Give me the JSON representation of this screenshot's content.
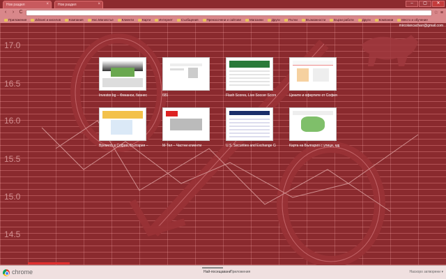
{
  "tabs": [
    {
      "label": "Нов раздел",
      "active": true
    },
    {
      "label": "Нов раздел",
      "active": false
    }
  ],
  "window": {
    "minimize": "–",
    "maximize": "▢",
    "close": "✕"
  },
  "toolbar": {
    "back": "‹",
    "forward": "›",
    "reload": "C",
    "omnibox_value": "",
    "star": "☆",
    "menu": "≡"
  },
  "bookmarks": [
    "Приложения",
    "Zdravei и киселов",
    "Компания",
    "Нос.Маговстье",
    "Клиенти",
    "Карти",
    "Интернет",
    "Съобщения",
    "Пренасочени и сайтове",
    "Магазини",
    "Други",
    "Пътни",
    "Възможности",
    "Бързи работи",
    "Други",
    "Компании",
    "Място и обучение"
  ],
  "user_email": "mircolancacharr@gmail.com",
  "axis_labels": [
    "17.0",
    "16.5",
    "16.0",
    "15.5",
    "15.0",
    "14.5"
  ],
  "thumbnails": [
    {
      "caption": "Investor.bg – Финанси, бизнес",
      "style": "investor"
    },
    {
      "caption": "681",
      "style": "plain"
    },
    {
      "caption": "Flash Scores, Live Soccer Scores, L...",
      "style": "flash"
    },
    {
      "caption": "Цените и офертите от София",
      "style": "prices"
    },
    {
      "caption": "Времето в София, България – S...",
      "style": "weather"
    },
    {
      "caption": "М-Тел – Частни клиенти",
      "style": "mtel"
    },
    {
      "caption": "U.S. Securities and Exchange Co...",
      "style": "sec"
    },
    {
      "caption": "Карта на България с улици, адр...",
      "style": "map"
    }
  ],
  "bottombar": {
    "brand": "chrome",
    "tab_most_visited": "Най-посещавани",
    "tab_apps": "Приложения",
    "recently_closed": "Наскоро затворени ▾"
  }
}
